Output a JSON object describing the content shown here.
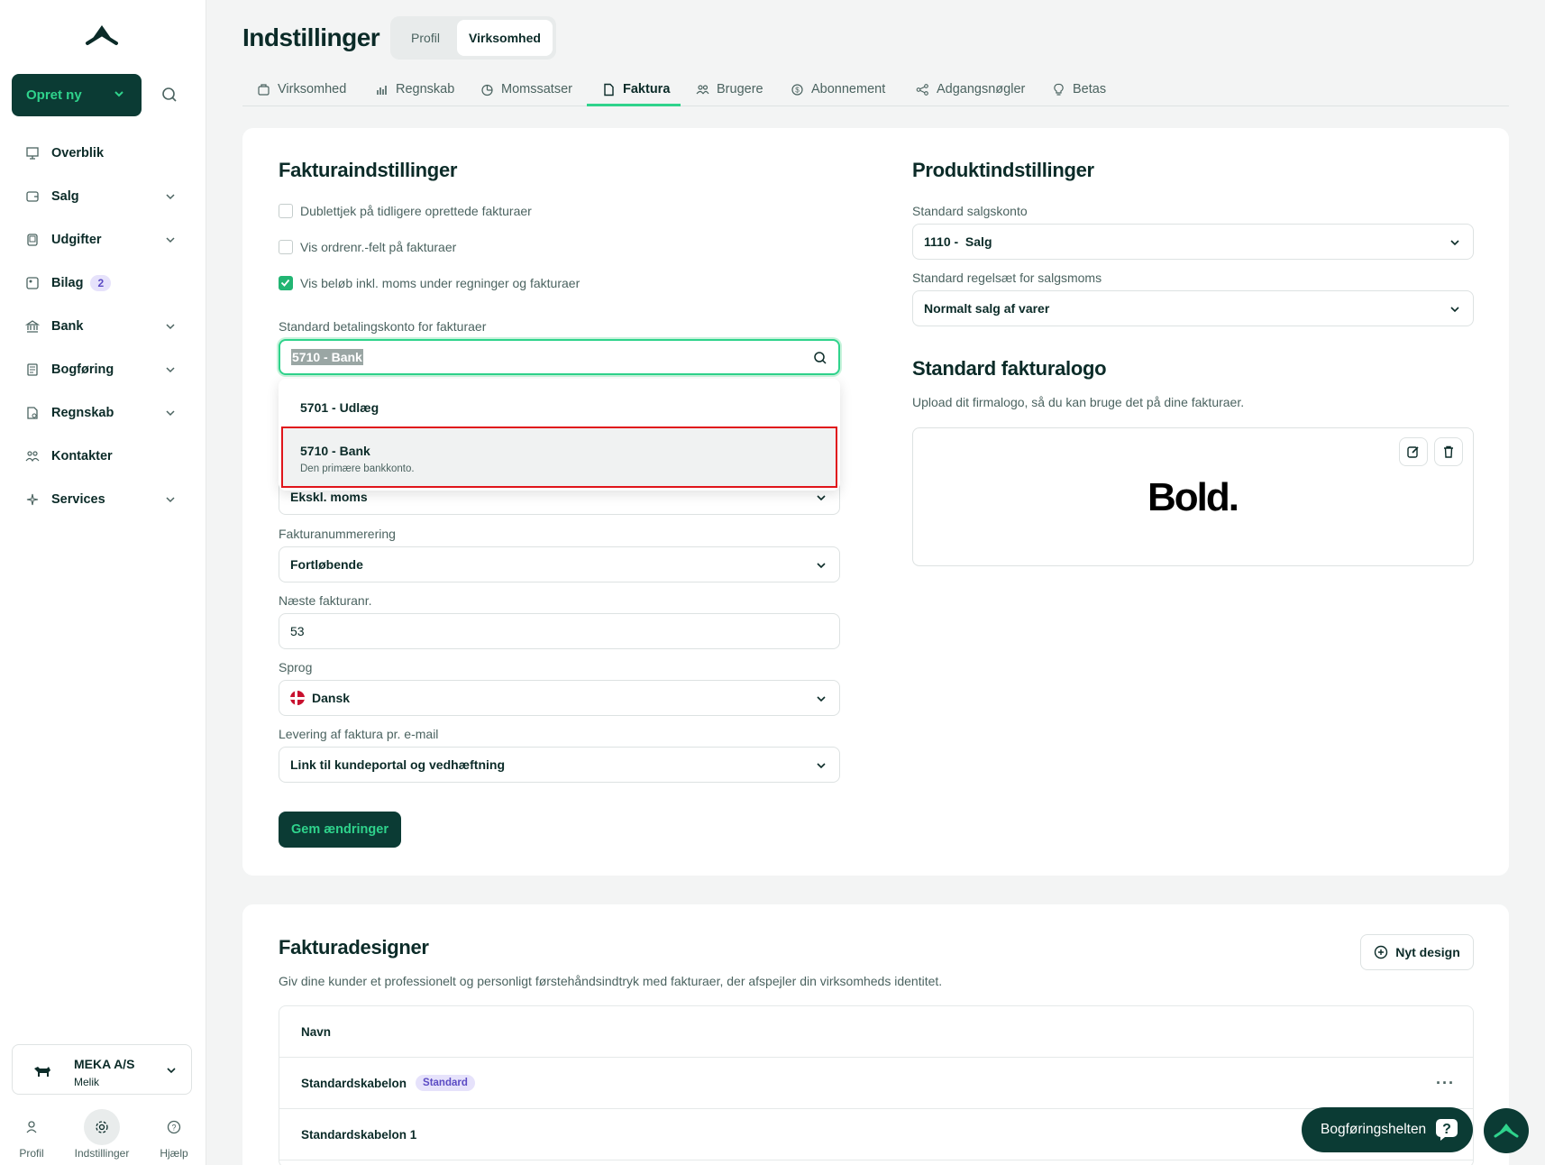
{
  "sidebar": {
    "create_label": "Opret ny",
    "items": [
      {
        "label": "Overblik",
        "icon": "presentation-icon"
      },
      {
        "label": "Salg",
        "icon": "wallet-icon"
      },
      {
        "label": "Udgifter",
        "icon": "receipt-icon"
      },
      {
        "label": "Bilag",
        "icon": "image-doc-icon",
        "badge": "2"
      },
      {
        "label": "Bank",
        "icon": "bank-icon"
      },
      {
        "label": "Bogføring",
        "icon": "ledger-icon"
      },
      {
        "label": "Regnskab",
        "icon": "report-icon"
      },
      {
        "label": "Kontakter",
        "icon": "people-icon"
      },
      {
        "label": "Services",
        "icon": "sparkle-icon"
      }
    ],
    "org": {
      "name": "MEKA A/S",
      "user": "Melik"
    },
    "bottom": {
      "profile": "Profil",
      "settings": "Indstillinger",
      "help": "Hjælp"
    }
  },
  "header": {
    "title": "Indstillinger",
    "segments": [
      "Profil",
      "Virksomhed"
    ],
    "tabs": [
      "Virksomhed",
      "Regnskab",
      "Momssatser",
      "Faktura",
      "Brugere",
      "Abonnement",
      "Adgangsnøgler",
      "Betas"
    ],
    "active_tab": "Faktura"
  },
  "invoice_settings": {
    "title": "Fakturaindstillinger",
    "checkboxes": [
      {
        "label": "Dublettjek på tidligere oprettede fakturaer",
        "checked": false
      },
      {
        "label": "Vis ordrenr.-felt på fakturaer",
        "checked": false
      },
      {
        "label": "Vis beløb inkl. moms under regninger og fakturaer",
        "checked": true
      }
    ],
    "payment_account_label": "Standard betalingskonto for fakturaer",
    "payment_account_value": "5710 - Bank",
    "dropdown_options": [
      {
        "label": "5701 - Udlæg"
      },
      {
        "label": "5710 - Bank",
        "desc": "Den primære bankkonto."
      }
    ],
    "vat_display_value": "Ekskl. moms",
    "numbering_label": "Fakturanummerering",
    "numbering_value": "Fortløbende",
    "next_number_label": "Næste fakturanr.",
    "next_number_value": "53",
    "language_label": "Sprog",
    "language_value": "Dansk",
    "delivery_label": "Levering af faktura pr. e-mail",
    "delivery_value": "Link til kundeportal og vedhæftning",
    "save_label": "Gem ændringer"
  },
  "product_settings": {
    "title": "Produktindstillinger",
    "sales_account_label": "Standard salgskonto",
    "sales_account_value": "1110 -  Salg",
    "vat_rule_label": "Standard regelsæt for salgsmoms",
    "vat_rule_value": "Normalt salg af varer"
  },
  "logo_section": {
    "title": "Standard fakturalogo",
    "desc": "Upload dit firmalogo, så du kan bruge det på dine fakturaer.",
    "logo_text": "Bold."
  },
  "designer": {
    "title": "Fakturadesigner",
    "desc": "Giv dine kunder et professionelt og personligt førstehåndsindtryk med fakturaer, der afspejler din virksomheds identitet.",
    "new_label": "Nyt design",
    "column": "Navn",
    "rows": [
      {
        "name": "Standardskabelon",
        "tag": "Standard"
      },
      {
        "name": "Standardskabelon 1"
      }
    ]
  },
  "help_label": "Bogføringshelten",
  "colors": {
    "brand_dark": "#0b3b34",
    "accent": "#2fd38c",
    "highlight": "#e0151b"
  }
}
